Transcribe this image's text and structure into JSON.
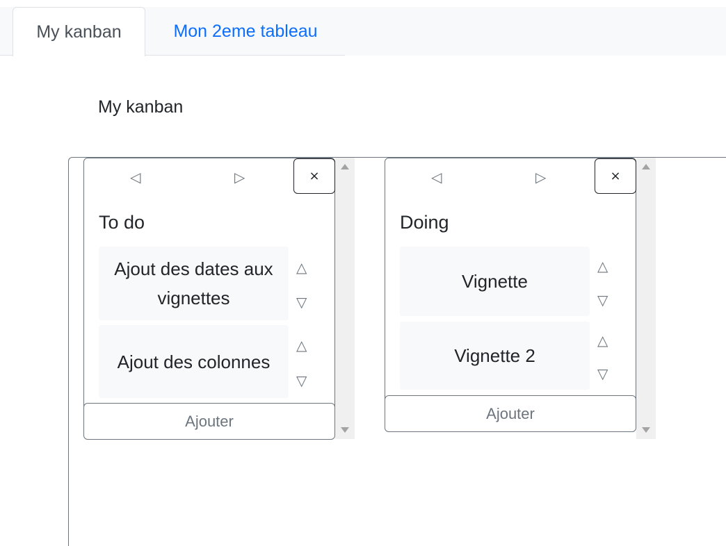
{
  "tabs": [
    {
      "label": "My kanban",
      "active": true
    },
    {
      "label": "Mon 2eme tableau",
      "active": false
    }
  ],
  "board": {
    "title": "My kanban"
  },
  "columns": [
    {
      "title": "To do",
      "cards": [
        {
          "text": "Ajout des dates aux vignettes"
        },
        {
          "text": "Ajout des colonnes"
        }
      ],
      "add_label": "Ajouter"
    },
    {
      "title": "Doing",
      "cards": [
        {
          "text": "Vignette"
        },
        {
          "text": "Vignette 2"
        }
      ],
      "add_label": "Ajouter"
    }
  ],
  "icons": {
    "left": "◁",
    "right": "▷",
    "close": "×",
    "up": "△",
    "down": "▽"
  },
  "colors": {
    "link": "#0d6efd",
    "card_bg": "#f8f9fa",
    "border": "#6c757d"
  }
}
